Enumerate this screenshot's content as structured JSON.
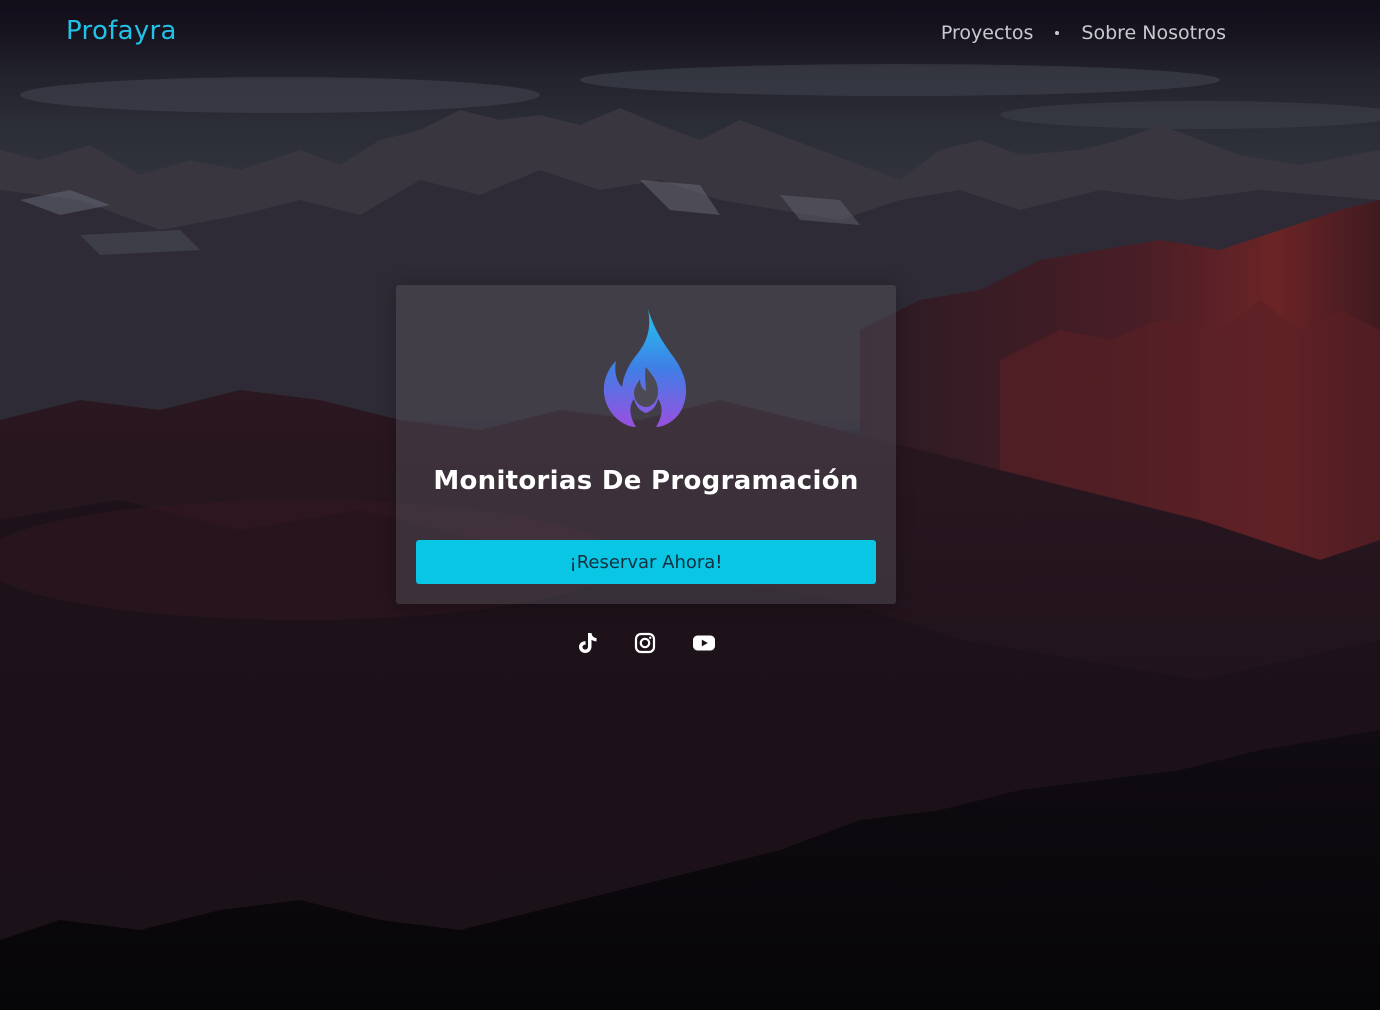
{
  "header": {
    "brand": "Profayra",
    "nav": {
      "item_1": "Proyectos",
      "item_2": "Sobre Nosotros"
    }
  },
  "hero": {
    "title": "Monitorias De Programación",
    "cta_label": "¡Reservar Ahora!",
    "logo_icon": "flame-logo-icon"
  },
  "socials": [
    "tiktok-icon",
    "instagram-icon",
    "youtube-icon"
  ],
  "colors": {
    "accent": "#08c6e4",
    "brand": "#21c2e6",
    "background": "#120f16"
  }
}
